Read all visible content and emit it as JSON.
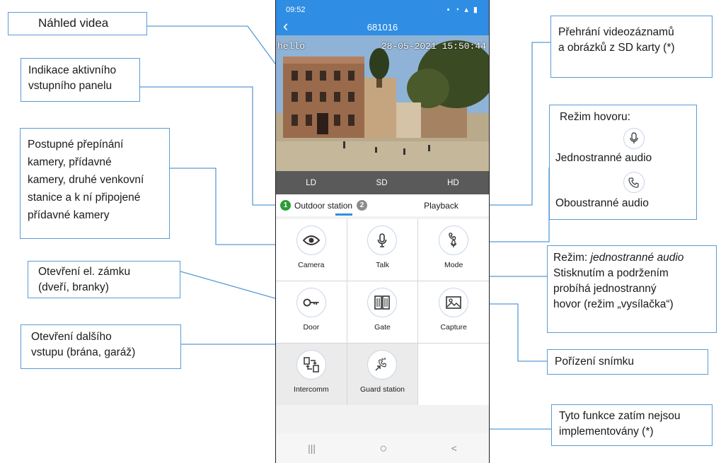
{
  "callouts": {
    "preview": {
      "lines": [
        "Náhled videa"
      ]
    },
    "active_panel": {
      "lines": [
        "Indikace aktivního",
        "vstupního panelu"
      ]
    },
    "camera_switch": {
      "lines": [
        "Postupné přepínání",
        "kamery, přídavné",
        "kamery, druhé venkovní",
        "stanice a k ní připojené",
        "přídavné kamery"
      ]
    },
    "door_open": {
      "lines": [
        "Otevření el. zámku",
        "(dveří, branky)"
      ]
    },
    "gate_open": {
      "lines": [
        "Otevření dalšího",
        "vstupu (brána, garáž)"
      ]
    },
    "playback": {
      "lines": [
        "Přehrání videozáznamů",
        "a obrázků z SD karty (*)"
      ]
    },
    "call_mode": {
      "title": "Režim hovoru:",
      "one_way": "Jednostranné audio",
      "two_way": "Oboustranné audio"
    },
    "talk_mode": {
      "prefix": "Režim: ",
      "mode": "jednostranné audio",
      "lines": [
        "Stisknutím a podržením",
        "probíhá jednostranný",
        "hovor (režim „vysílačka“)"
      ]
    },
    "capture": {
      "lines": [
        "Pořízení snímku"
      ]
    },
    "not_implemented": {
      "lines": [
        "Tyto funkce zatím nejsou",
        "implementovány (*)"
      ]
    }
  },
  "phone": {
    "status_time": "09:52",
    "title": "681016",
    "osd_name": "hello",
    "osd_datetime": "28-05-2021 15:50:44",
    "quality": [
      "LD",
      "SD",
      "HD"
    ],
    "tabs": {
      "station_number": "1",
      "station_label": "Outdoor station",
      "station2_number": "2",
      "playback_label": "Playback"
    },
    "buttons": [
      {
        "label": "Camera",
        "icon": "eye-icon"
      },
      {
        "label": "Talk",
        "icon": "microphone-icon"
      },
      {
        "label": "Mode",
        "icon": "phone-mic-icon"
      },
      {
        "label": "Door",
        "icon": "key-icon"
      },
      {
        "label": "Gate",
        "icon": "gate-icon"
      },
      {
        "label": "Capture",
        "icon": "image-icon"
      },
      {
        "label": "Intercomm",
        "icon": "intercom-icon"
      },
      {
        "label": "Guard station",
        "icon": "guard-icon"
      }
    ],
    "nav": [
      "|||",
      "○",
      "<"
    ]
  },
  "colors": {
    "accent": "#2f8de4",
    "callout_border": "#5b9bd5",
    "active_green": "#2e9b36",
    "inactive_grey": "#8c8c8c"
  }
}
